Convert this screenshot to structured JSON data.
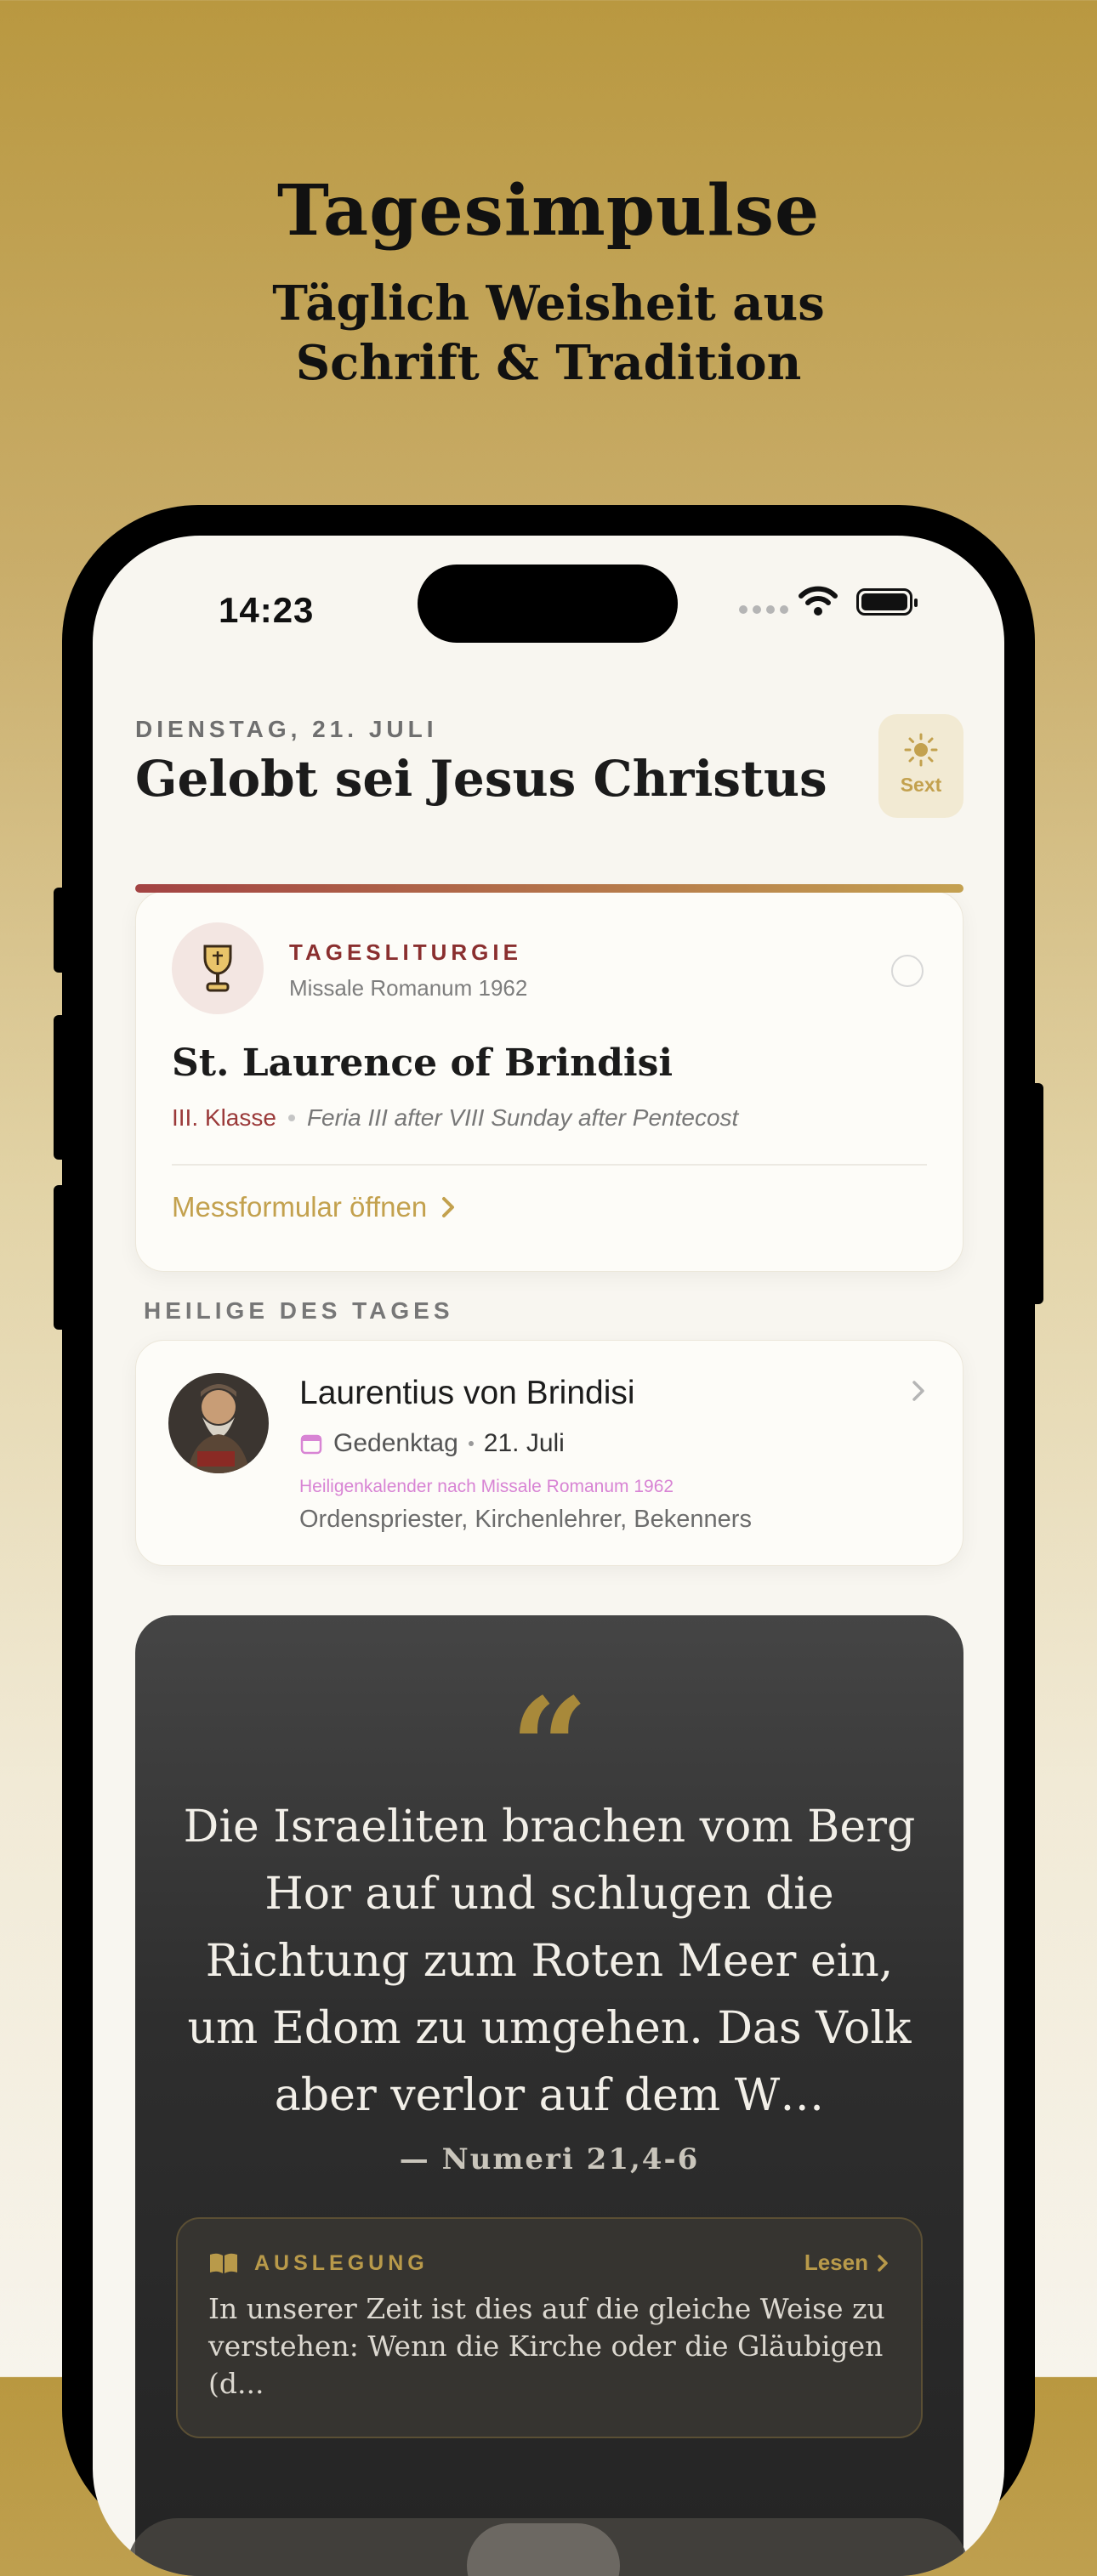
{
  "promo": {
    "title": "Tagesimpulse",
    "subtitle_line1": "Täglich Weisheit aus",
    "subtitle_line2": "Schrift & Tradition"
  },
  "status_bar": {
    "time": "14:23"
  },
  "header": {
    "date": "DIENSTAG, 21. JULI",
    "greeting": "Gelobt sei Jesus Christus",
    "hour_button_label": "Sext",
    "hour_icon": "sun-icon"
  },
  "liturgy": {
    "kicker": "TAGESLITURGIE",
    "subtitle": "Missale Romanum 1962",
    "title": "St. Laurence of Brindisi",
    "class": "III. Klasse",
    "feria": "Feria III after VIII Sunday after Pentecost",
    "open_link": "Messformular öffnen",
    "icon": "chalice-icon"
  },
  "saints": {
    "section_label": "HEILIGE DES TAGES",
    "name": "Laurentius von Brindisi",
    "rank": "Gedenktag",
    "date": "21. Juli",
    "calendar_note": "Heiligenkalender nach Missale Romanum 1962",
    "roles": "Ordenspriester, Kirchenlehrer, Bekenners"
  },
  "quote": {
    "mark": "“",
    "text": "Die Israeliten brachen vom Berg Hor auf und schlugen die Richtung zum Roten Meer ein, um Edom zu umgehen. Das Volk aber verlor auf dem W…",
    "reference": "— Numeri 21,4-6"
  },
  "auslegung": {
    "label": "AUSLEGUNG",
    "read_label": "Lesen",
    "text": "In unserer Zeit ist dies auf die gleiche Weise zu verstehen: Wenn die Kirche oder die Gläubigen (d..."
  },
  "colors": {
    "gold": "#c3a14e",
    "burgundy": "#8a2f2f",
    "dark_card": "#2e2e2e"
  }
}
